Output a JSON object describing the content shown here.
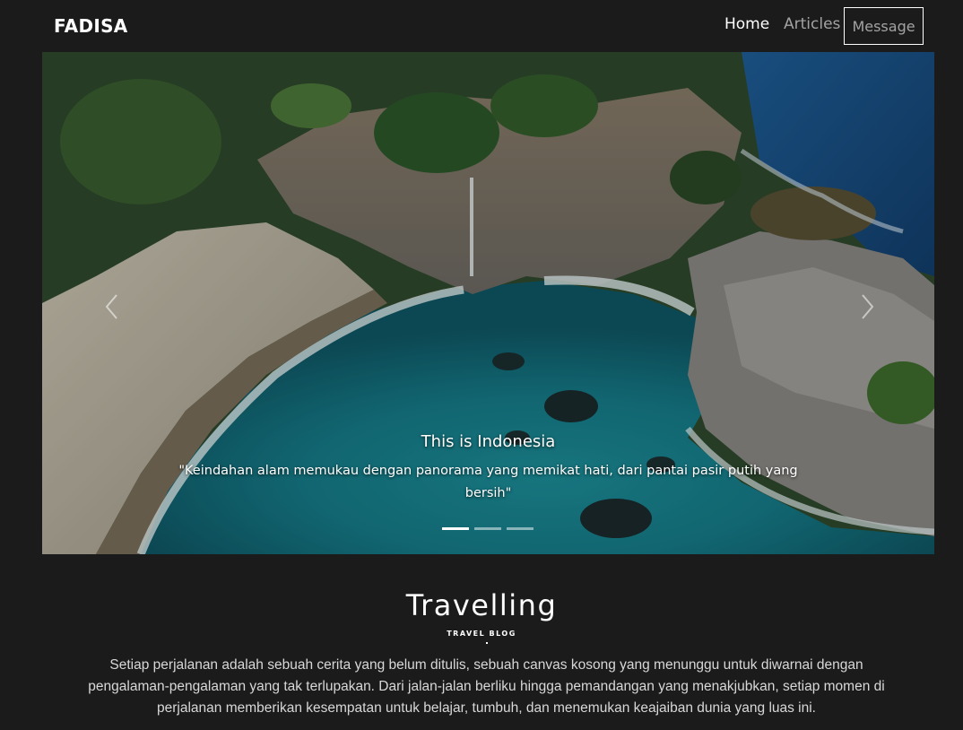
{
  "navbar": {
    "brand": "FADISA",
    "links": {
      "home": "Home",
      "articles": "Articles",
      "message": "Message"
    }
  },
  "carousel": {
    "caption_title": "This is Indonesia",
    "caption_text": "\"Keindahan alam memukau dengan panorama yang memikat hati, dari pantai pasir putih yang bersih\"",
    "slide_count": 3,
    "active_slide": 1,
    "prev_icon": "chevron-left-icon",
    "next_icon": "chevron-right-icon"
  },
  "section": {
    "title": "Travelling",
    "subtitle": "TRAVEL BLOG",
    "body": "Setiap perjalanan adalah sebuah cerita yang belum ditulis, sebuah canvas kosong yang menunggu untuk diwarnai dengan pengalaman-pengalaman yang tak terlupakan. Dari jalan-jalan berliku hingga pemandangan yang menakjubkan, setiap momen di perjalanan memberikan kesempatan untuk belajar, tumbuh, dan menemukan keajaiban dunia yang luas ini."
  },
  "colors": {
    "background": "#1b1b1b",
    "nav_active": "#ffffff",
    "nav_muted": "#a3a3a3",
    "body_text": "#d8d8d8"
  }
}
